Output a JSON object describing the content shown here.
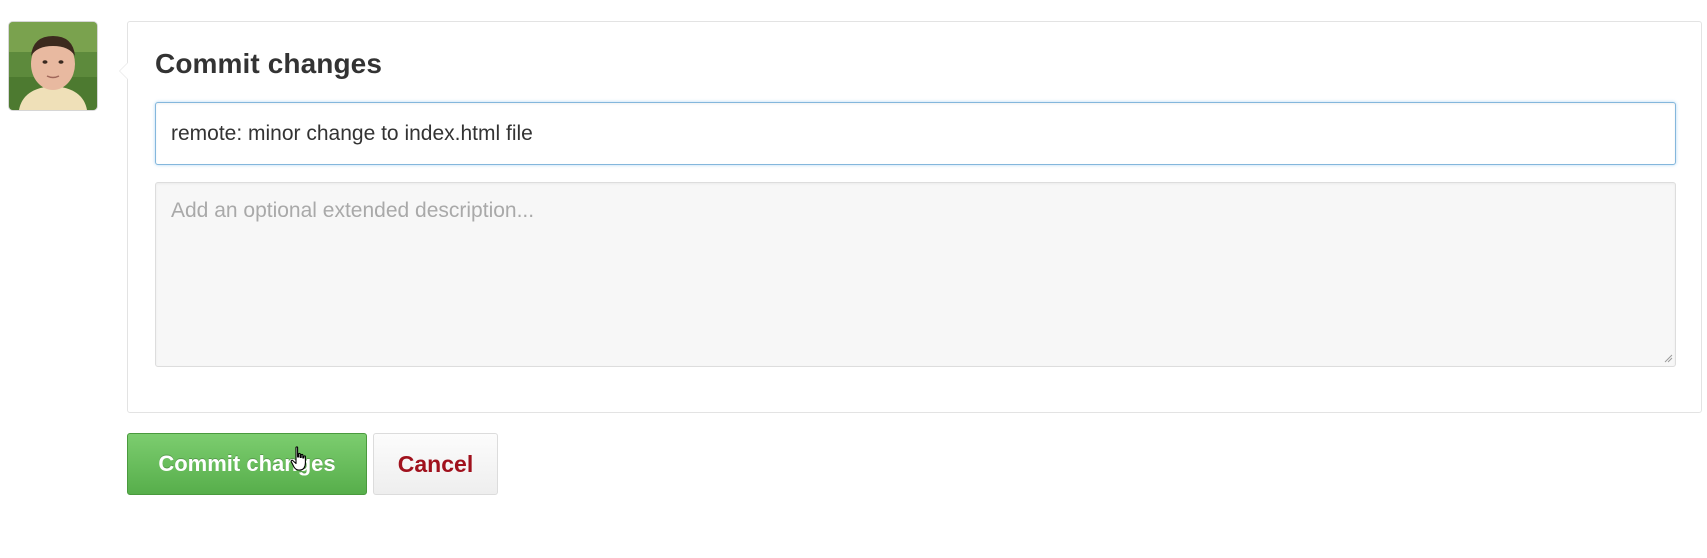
{
  "user": {
    "avatar_icon": "user-avatar-photo"
  },
  "commit_form": {
    "title": "Commit changes",
    "summary_value": "remote: minor change to index.html file",
    "description_placeholder": "Add an optional extended description...",
    "description_value": ""
  },
  "actions": {
    "commit_label": "Commit changes",
    "cancel_label": "Cancel"
  },
  "colors": {
    "commit_button": "#5cb44f",
    "cancel_text": "#a0111d",
    "input_focus_border": "#84b7dc"
  },
  "cursor": {
    "icon": "hand-pointer-icon"
  }
}
